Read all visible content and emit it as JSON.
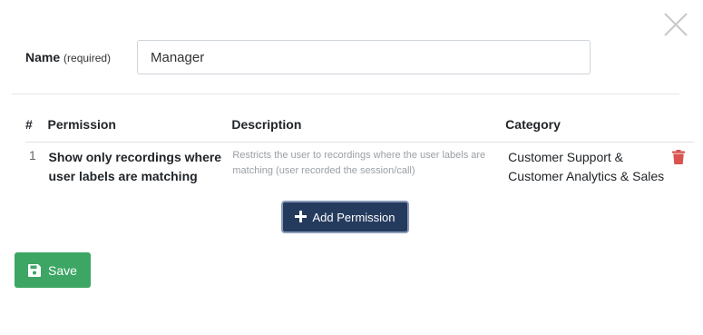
{
  "form": {
    "name_label": "Name",
    "name_required": "(required)",
    "name_value": "Manager"
  },
  "table": {
    "headers": {
      "num": "#",
      "permission": "Permission",
      "description": "Description",
      "category": "Category"
    },
    "rows": [
      {
        "num": "1",
        "permission": "Show only recordings where user labels are matching",
        "description": "Restricts the user to recordings where the user labels are matching (user recorded the session/call)",
        "category": "Customer Support & Customer Analytics & Sales"
      }
    ]
  },
  "actions": {
    "add_permission_label": "Add Permission",
    "save_label": "Save"
  },
  "icons": {
    "close": "close-icon",
    "trash": "trash-icon",
    "plus": "plus-icon",
    "save": "floppy-disk-icon"
  },
  "colors": {
    "save_button": "#3da664",
    "add_button": "#253b5e",
    "trash": "#d9534f"
  }
}
